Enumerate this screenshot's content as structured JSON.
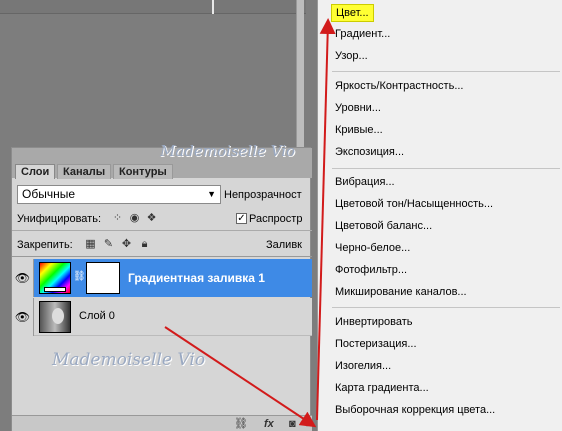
{
  "panel": {
    "tabs": [
      "Слои",
      "Каналы",
      "Контуры"
    ],
    "blend_mode": "Обычные",
    "opacity_label": "Непрозрачност",
    "unify_label": "Унифицировать:",
    "spread_label": "Распростр",
    "lock_label": "Закрепить:",
    "fill_label": "Заливк",
    "layers": [
      {
        "name": "Градиентная заливка 1",
        "selected": true
      },
      {
        "name": "Слой 0",
        "selected": false
      }
    ]
  },
  "watermarks": {
    "top": "Mademoiselle Vio",
    "bottom": "Mademoiselle Vio"
  },
  "menu": {
    "groups": [
      [
        "Цвет...",
        "Градиент...",
        "Узор..."
      ],
      [
        "Яркость/Контрастность...",
        "Уровни...",
        "Кривые...",
        "Экспозиция..."
      ],
      [
        "Вибрация...",
        "Цветовой тон/Насыщенность...",
        "Цветовой баланс...",
        "Черно-белое...",
        "Фотофильтр...",
        "Микширование каналов..."
      ],
      [
        "Инвертировать",
        "Постеризация...",
        "Изогелия...",
        "Карта градиента...",
        "Выборочная коррекция цвета..."
      ]
    ],
    "highlighted": "Цвет...",
    "highlight_color": "#ffff33"
  },
  "colors": {
    "selected_layer": "#3e8ae6",
    "arrow": "#d21b1b"
  },
  "icons": {
    "eye": "eye-icon",
    "link": "link-icon",
    "fx": "fx-icon",
    "adjustment": "adjustment-layer-icon"
  }
}
